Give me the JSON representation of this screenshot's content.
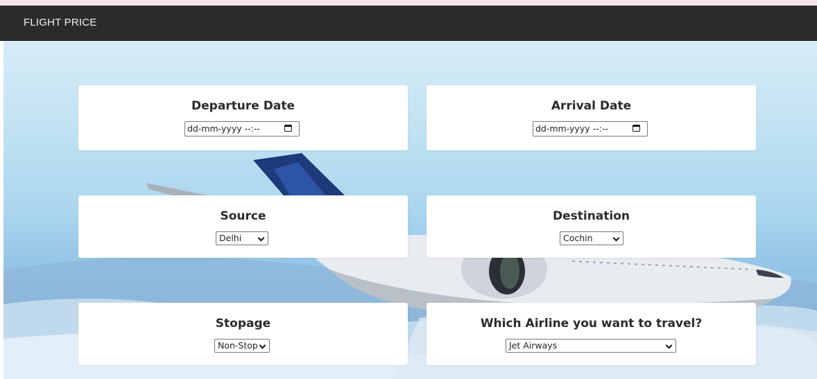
{
  "navbar": {
    "brand": "FLIGHT PRICE"
  },
  "form": {
    "departure": {
      "label": "Departure Date",
      "value": "dd-mm-yyyy --:--",
      "icon": "calendar-icon"
    },
    "arrival": {
      "label": "Arrival Date",
      "value": "dd-mm-yyyy --:--",
      "icon": "calendar-icon"
    },
    "source": {
      "label": "Source",
      "selected": "Delhi"
    },
    "destination": {
      "label": "Destination",
      "selected": "Cochin"
    },
    "stopage": {
      "label": "Stopage",
      "selected": "Non-Stop"
    },
    "airline": {
      "label": "Which Airline you want to travel?",
      "selected": "Jet Airways"
    }
  },
  "colors": {
    "navbar": "#2b2b2b",
    "card": "#ffffff",
    "sky": "#aad6ee"
  }
}
